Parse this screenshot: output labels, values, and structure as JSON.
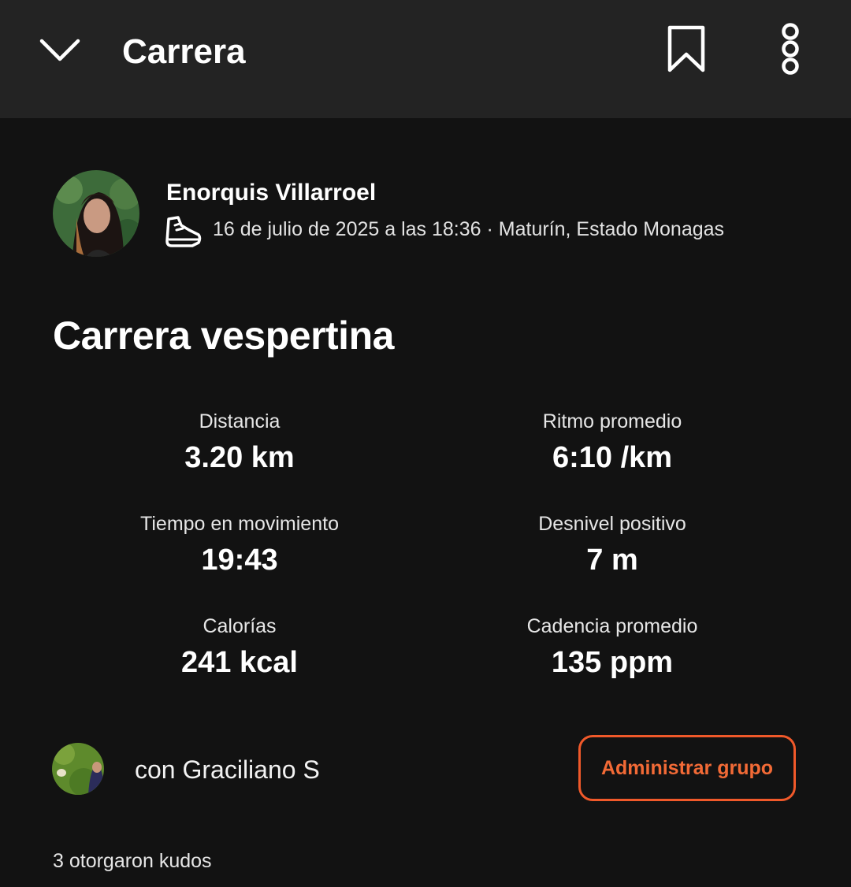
{
  "header": {
    "title": "Carrera",
    "back_icon": "chevron-down-icon",
    "bookmark_icon": "bookmark-icon",
    "more_icon": "more-vertical-icon"
  },
  "athlete": {
    "name": "Enorquis Villarroel",
    "activity_icon": "running-shoe-icon",
    "meta": "16 de julio de 2025 a las 18:36 · Maturín, Estado Monagas"
  },
  "activity": {
    "title": "Carrera vespertina"
  },
  "stats": [
    {
      "label": "Distancia",
      "value": "3.20 km"
    },
    {
      "label": "Ritmo promedio",
      "value": "6:10 /km"
    },
    {
      "label": "Tiempo en movimiento",
      "value": "19:43"
    },
    {
      "label": "Desnivel positivo",
      "value": "7 m"
    },
    {
      "label": "Calorías",
      "value": "241 kcal"
    },
    {
      "label": "Cadencia promedio",
      "value": "135 ppm"
    }
  ],
  "group": {
    "text": "con Graciliano S",
    "manage_label": "Administrar grupo"
  },
  "kudos": {
    "text": "3 otorgaron kudos"
  },
  "colors": {
    "accent": "#f0592a",
    "background": "#121212",
    "topbar": "#232323"
  }
}
